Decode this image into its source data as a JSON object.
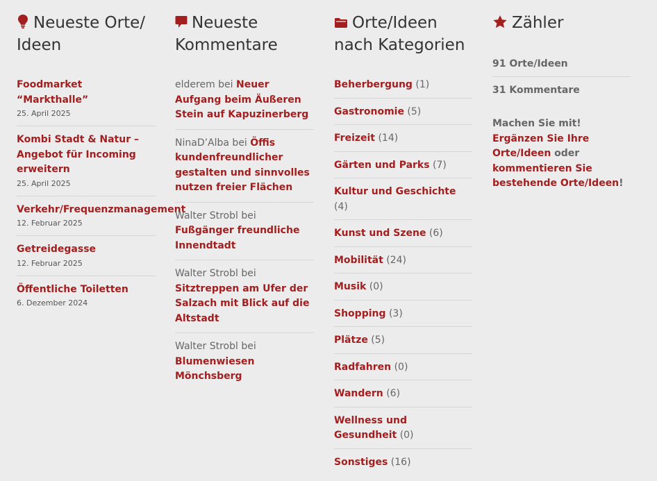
{
  "colors": {
    "accent": "#a31f1f",
    "background": "#ececec"
  },
  "recent_posts": {
    "title": "Neueste Orte/ Ideen",
    "icon": "lightbulb-icon",
    "items": [
      {
        "title": "Foodmarket “Markthalle”",
        "date": "25. April 2025"
      },
      {
        "title": "Kombi Stadt & Natur – Angebot für Incoming erweitern",
        "date": "25. April 2025"
      },
      {
        "title": "Verkehr/Frequenzmanagement",
        "date": "12. Februar 2025"
      },
      {
        "title": "Getreidegasse",
        "date": "12. Februar 2025"
      },
      {
        "title": "Öffentliche Toiletten",
        "date": "6. Dezember 2024"
      }
    ]
  },
  "recent_comments": {
    "title": "Neueste Kommentare",
    "icon": "comment-icon",
    "items": [
      {
        "author": "elderem",
        "sep": " bei ",
        "post": "Neuer Aufgang beim Äußeren Stein auf Kapuzinerberg"
      },
      {
        "author": "NinaD’Alba",
        "sep": " bei ",
        "post": "Öffis kundenfreundlicher gestalten und sinnvolles nutzen freier Flächen"
      },
      {
        "author": "Walter Strobl",
        "sep": " bei ",
        "post": "Fußgänger freundliche Innendtadt"
      },
      {
        "author": "Walter Strobl",
        "sep": " bei ",
        "post": "Sitztreppen am Ufer der Salzach mit Blick auf die Altstadt"
      },
      {
        "author": "Walter Strobl",
        "sep": " bei ",
        "post": "Blumenwiesen Mönchsberg"
      }
    ]
  },
  "categories": {
    "title": "Orte/Ideen nach Kategorien",
    "icon": "folder-icon",
    "items": [
      {
        "name": "Beherbergung",
        "count": "(1)"
      },
      {
        "name": "Gastronomie",
        "count": "(5)"
      },
      {
        "name": "Freizeit",
        "count": "(14)"
      },
      {
        "name": "Gärten und Parks",
        "count": "(7)"
      },
      {
        "name": "Kultur und Geschichte",
        "count": "(4)"
      },
      {
        "name": "Kunst und Szene",
        "count": "(6)"
      },
      {
        "name": "Mobilität",
        "count": "(24)"
      },
      {
        "name": "Musik",
        "count": "(0)"
      },
      {
        "name": "Shopping",
        "count": "(3)"
      },
      {
        "name": "Plätze",
        "count": "(5)"
      },
      {
        "name": "Radfahren",
        "count": "(0)"
      },
      {
        "name": "Wandern",
        "count": "(6)"
      },
      {
        "name": "Wellness und Gesundheit",
        "count": "(0)"
      },
      {
        "name": "Sonstiges",
        "count": "(16)"
      }
    ]
  },
  "counter": {
    "title": "Zähler",
    "icon": "star-icon",
    "places": "91 Orte/Ideen",
    "comments": "31 Kommentare",
    "cta_prefix": "Machen Sie mit! ",
    "cta_link1": "Ergänzen Sie Ihre Orte/Ideen",
    "cta_mid": " oder ",
    "cta_link2": "kommentieren Sie bestehende Orte/Ideen",
    "cta_suffix": "!"
  }
}
